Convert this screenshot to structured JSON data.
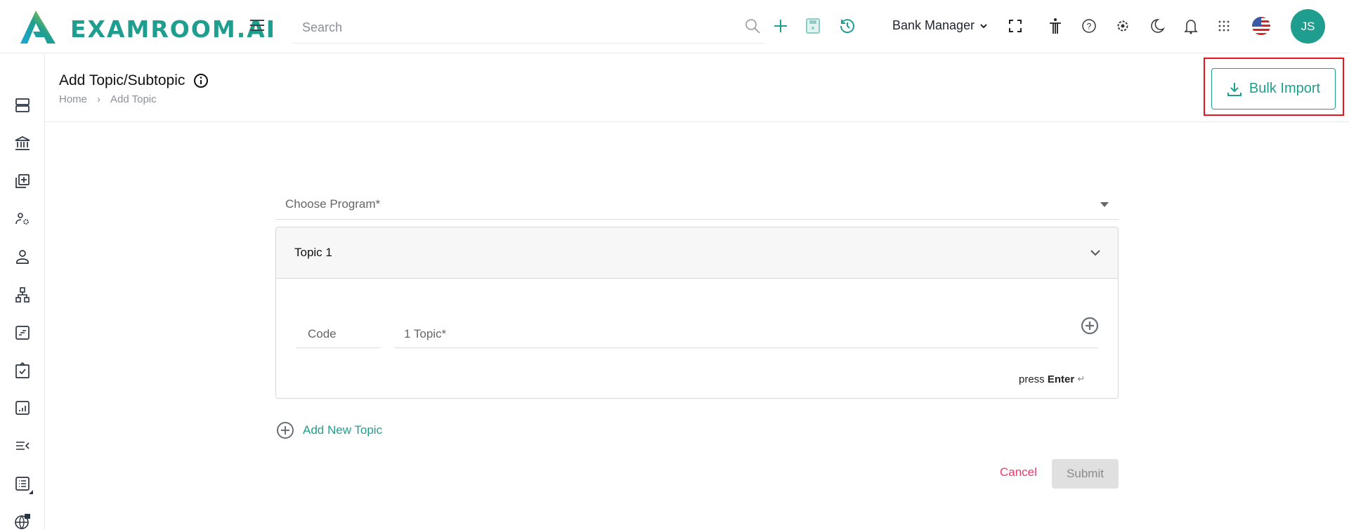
{
  "header": {
    "logo_text": "EXAMROOM.AI",
    "search_placeholder": "Search",
    "role": "Bank Manager",
    "avatar_initials": "JS",
    "icons": [
      "menu-icon",
      "search-icon",
      "plus-icon",
      "save-icon",
      "history-icon",
      "chevron-down-icon",
      "fullscreen-icon",
      "accessibility-icon",
      "help-icon",
      "gear-icon",
      "moon-icon",
      "bell-icon",
      "apps-grid-icon",
      "us-flag-icon"
    ]
  },
  "sidebar": {
    "icons": [
      "server-icon",
      "bank-icon",
      "add-library-icon",
      "user-settings-icon",
      "user-icon",
      "hierarchy-icon",
      "form-icon",
      "clipboard-check-icon",
      "report-chart-icon",
      "collapse-list-icon",
      "list-icon",
      "globe-icon"
    ]
  },
  "page": {
    "title": "Add Topic/Subtopic",
    "breadcrumb": [
      "Home",
      "Add Topic"
    ],
    "bulk_import_label": "Bulk Import"
  },
  "form": {
    "program_placeholder": "Choose Program*",
    "topic_panel_title": "Topic 1",
    "code_placeholder": "Code",
    "topic_placeholder": "1 Topic*",
    "press_label": "press",
    "enter_label": "Enter",
    "add_new_topic_label": "Add New Topic",
    "cancel_label": "Cancel",
    "submit_label": "Submit"
  },
  "colors": {
    "accent": "#1f9e8f",
    "cancel": "#f0386b",
    "highlight": "#e8141b"
  }
}
